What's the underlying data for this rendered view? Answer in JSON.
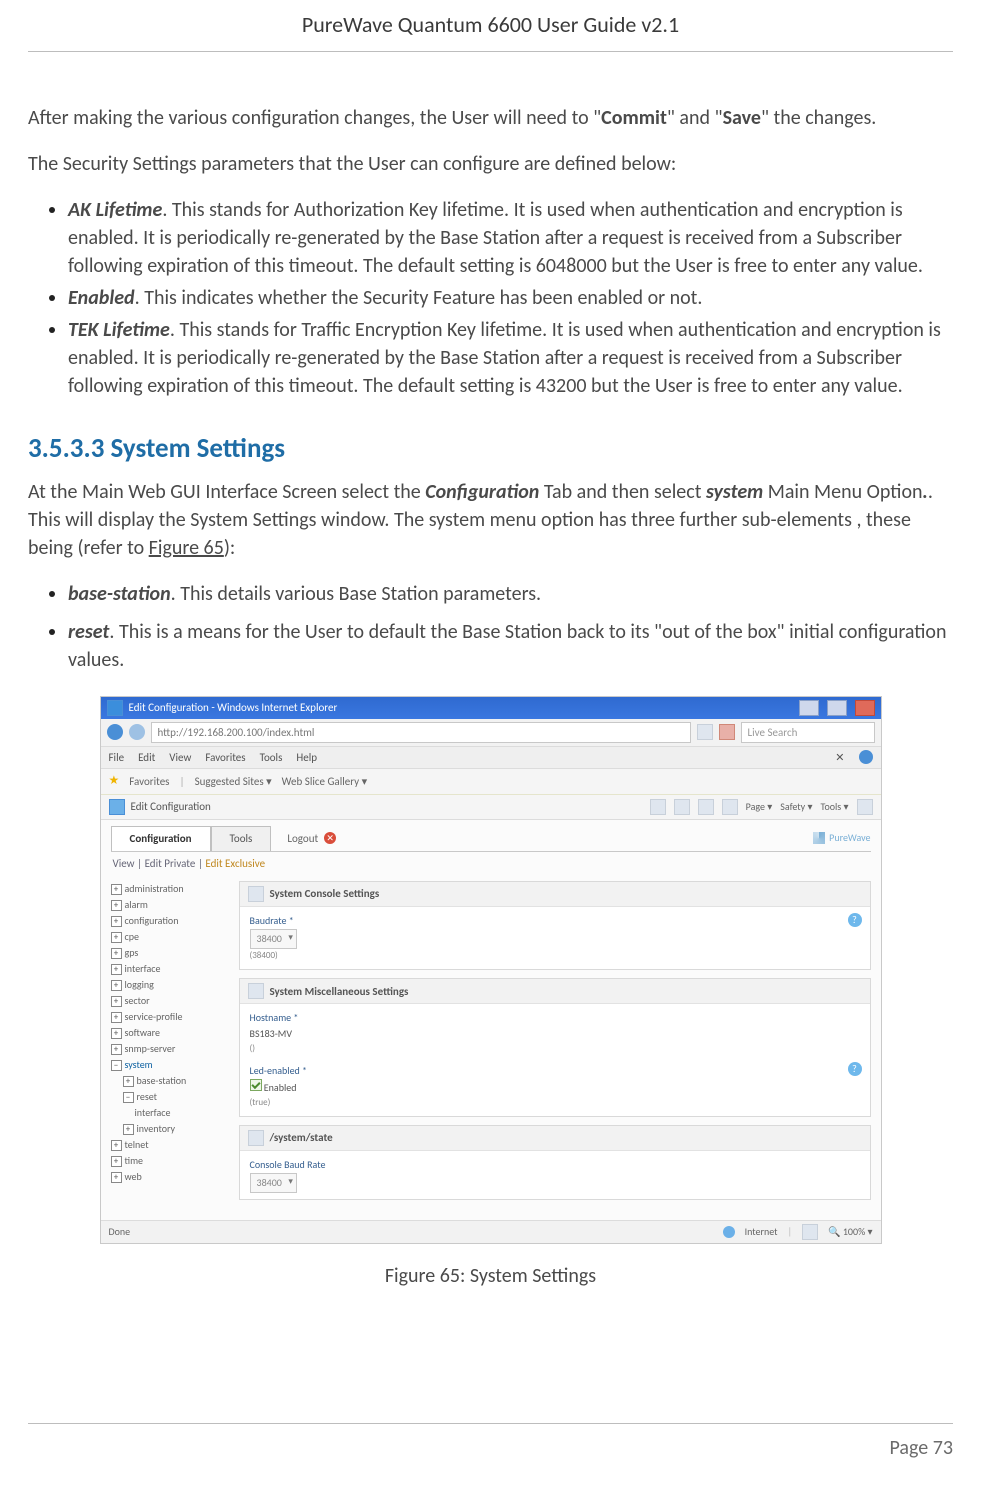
{
  "doc": {
    "header_title": "PureWave Quantum 6600 User Guide v2.1",
    "page_line": "Page 73"
  },
  "intro": {
    "p1_a": "After making the various configuration changes, the User will need to \"",
    "p1_b": "Commit",
    "p1_c": "\" and \"",
    "p1_d": "Save",
    "p1_e": "\" the changes.",
    "p2": "The Security Settings parameters that the User can configure are defined below:"
  },
  "sec_params": [
    {
      "title": "AK Lifetime",
      "text": ". This stands for Authorization Key lifetime. It is used when authentication and encryption is enabled. It is periodically re-generated by the Base Station after a request is received from a Subscriber following expiration of this timeout. The default setting is 6048000 but the User is free to enter any value."
    },
    {
      "title": "Enabled",
      "text": ". This indicates whether the Security Feature has been enabled or not."
    },
    {
      "title": "TEK Lifetime",
      "text": ". This stands for Traffic Encryption Key lifetime. It is used when authentication and encryption is enabled. It is periodically re-generated by the Base Station after a request is received from a Subscriber following expiration of this timeout. The default setting is 43200 but the User is free to enter any value."
    }
  ],
  "section": {
    "heading": "3.5.3.3 System Settings",
    "p_a": "At the Main Web GUI Interface Screen select the ",
    "p_b": "Configuration",
    "p_c": " Tab and then select ",
    "p_d": "system",
    "p_e": " Main Menu Option",
    "p_f": ". This will display the System Settings window. The system menu option has three further sub-elements , these being (refer to ",
    "p_g": "Figure 65",
    "p_h": "):"
  },
  "sys_items": [
    {
      "title": "base-station",
      "text": ". This details various Base Station parameters."
    },
    {
      "title": "reset",
      "text": ". This is a means for the User to default the Base Station back to its \"out of the box\" initial configuration values."
    }
  ],
  "ie": {
    "title": "Edit Configuration - Windows Internet Explorer",
    "url_a": "http://192.168.200.100/index.html",
    "menu": [
      "File",
      "Edit",
      "View",
      "Favorites",
      "Tools",
      "Help"
    ],
    "fav_label": "Favorites",
    "fav_items": [
      "Suggested Sites ▾",
      "Web Slice Gallery ▾"
    ],
    "tab_label": "Edit Configuration",
    "toolbar": [
      "Page ▾",
      "Safety ▾",
      "Tools ▾"
    ],
    "status_done": "Done",
    "status_zone": "Internet",
    "status_zoom": "100%"
  },
  "app": {
    "tabs": {
      "config": "Configuration",
      "tools": "Tools",
      "logout": "Logout"
    },
    "brand": "PureWave",
    "view_line_a": "View  |  Edit Private  |  ",
    "view_line_b": "Edit Exclusive",
    "tree": {
      "items": [
        "administration",
        "alarm",
        "configuration",
        "cpe",
        "gps",
        "interface",
        "logging",
        "sector",
        "service-profile",
        "software",
        "snmp-server"
      ],
      "system_label": "system",
      "system_children": [
        "base-station",
        "reset",
        "interface",
        "inventory"
      ],
      "items_after": [
        "telnet",
        "time",
        "web"
      ]
    },
    "panel1": {
      "title": "System Console Settings",
      "label": "Baudrate *",
      "val": "38400",
      "sub": "(38400)"
    },
    "panel2": {
      "title": "System Miscellaneous Settings",
      "host_label": "Hostname *",
      "host_val": "BS183-MV",
      "host_sub": "()",
      "led_label": "Led-enabled *",
      "led_val": "Enabled",
      "led_sub": "(true)"
    },
    "panel3": {
      "title": "/system/state",
      "label": "Console Baud Rate",
      "val": "38400"
    }
  },
  "caption": "Figure 65: System Settings"
}
